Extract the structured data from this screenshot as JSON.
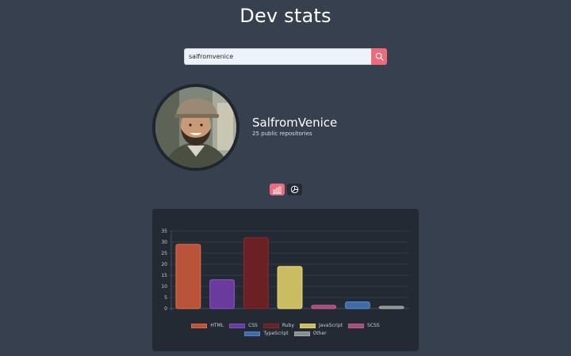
{
  "header": {
    "title": "Dev stats"
  },
  "search": {
    "value": "salfromvenice",
    "button_icon": "search-icon"
  },
  "profile": {
    "name": "SalfromVenice",
    "repos_text": "25 public repositories"
  },
  "view_toggle": {
    "options": [
      {
        "icon": "bar-chart-icon",
        "active": true
      },
      {
        "icon": "pie-chart-icon",
        "active": false
      }
    ]
  },
  "colors": {
    "accent": "#eb6c7f",
    "background": "#36404f",
    "card": "#232a33"
  },
  "chart_data": {
    "type": "bar",
    "categories": [
      "HTML",
      "CSS",
      "Ruby",
      "JavaScript",
      "SCSS",
      "TypeScript",
      "Other"
    ],
    "values": [
      29,
      13,
      32,
      19,
      1.5,
      3,
      1
    ],
    "colors": [
      "#b9533a",
      "#6a3a9c",
      "#6b2123",
      "#c9bc62",
      "#a34f7c",
      "#3f6aa6",
      "#8a8c90"
    ],
    "border_colors": [
      "#d86848",
      "#8050c0",
      "#7d2a2c",
      "#e0d270",
      "#c05a8e",
      "#5584c8",
      "#a7a9ad"
    ],
    "ylim": [
      0,
      35
    ],
    "yticks": [
      0,
      5,
      10,
      15,
      20,
      25,
      30,
      35
    ],
    "grid": true,
    "legend_position": "bottom"
  }
}
